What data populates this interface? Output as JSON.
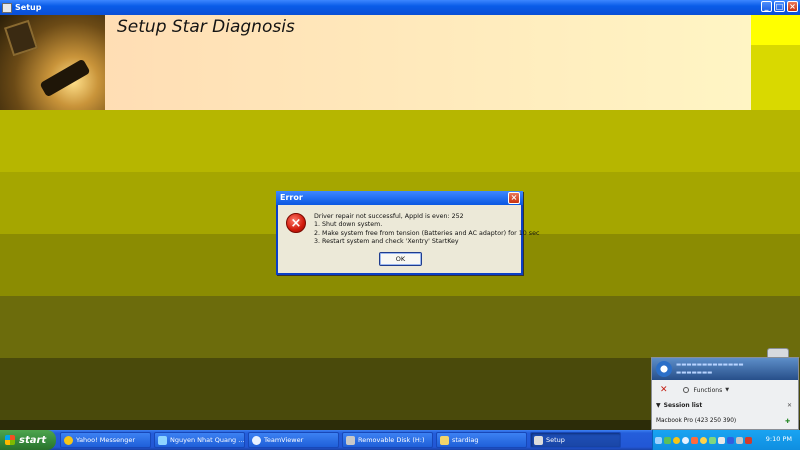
{
  "window": {
    "title": "Setup"
  },
  "banner": {
    "title": "Setup Star Diagnosis"
  },
  "dialog": {
    "title": "Error",
    "lines": [
      "Driver repair not successful, AppId is even: 252",
      "1. Shut down system.",
      "2. Make system free from tension (Batteries and AC adaptor) for 10 sec",
      "3. Restart system and check 'Xentry' StartKey"
    ],
    "ok_label": "OK"
  },
  "teamviewer": {
    "functions_label": "Functions",
    "session_list_label": "Session list",
    "device": "Macbook Pro (423 250 390)"
  },
  "taskbar": {
    "start_label": "start",
    "tasks": [
      {
        "label": "Yahoo! Messenger"
      },
      {
        "label": "Nguyen Nhat Quang ..."
      },
      {
        "label": "TeamViewer"
      },
      {
        "label": "Removable Disk (H:)"
      },
      {
        "label": "stardiag"
      },
      {
        "label": "Setup"
      }
    ],
    "clock": "9:10 PM"
  },
  "colors": {
    "stripes": [
      "#c3c300",
      "#a7a800",
      "#8e8e02",
      "#6d6d0c",
      "#4d4d0b",
      "#2c2c08"
    ],
    "banner_accent": "#ffff00",
    "xp_blue": "#245edb",
    "start_green": "#3c8f3c"
  }
}
